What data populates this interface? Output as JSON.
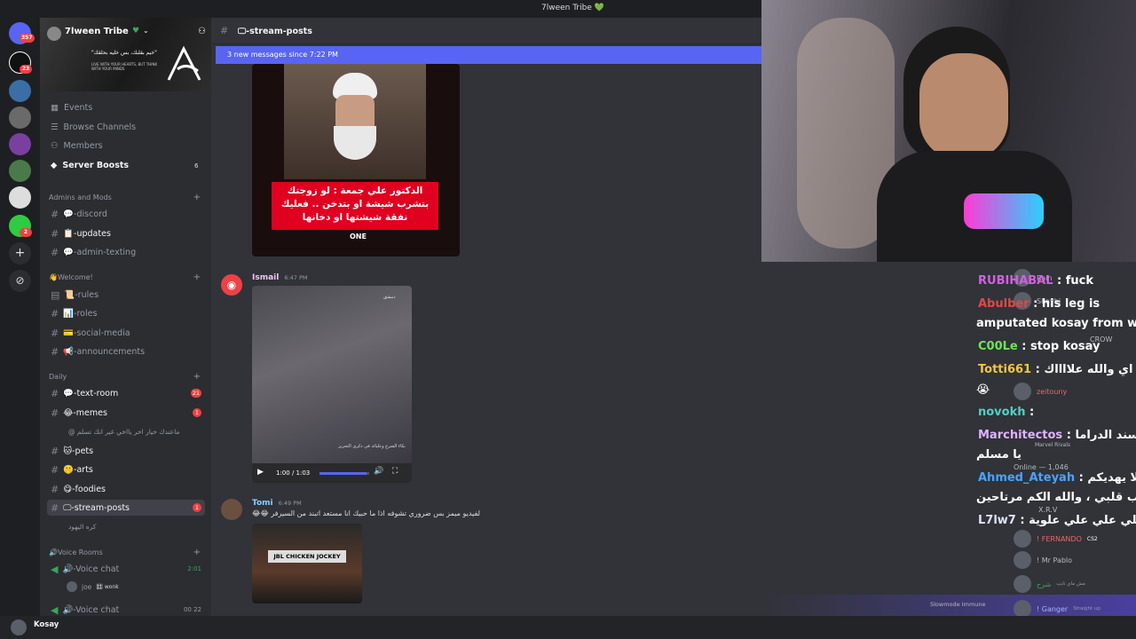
{
  "topbar": {
    "title": "7lween Tribe 💚"
  },
  "server_rail": {
    "badges": [
      "357",
      "23",
      "2"
    ]
  },
  "server": {
    "name": "7lween Tribe",
    "banner_text": "\"خيم بقلبك، بس خليه بحلقك\"",
    "banner_subtext": "LIVE WITH YOUR HEARTS, BUT THINK WITH YOUR MINDS"
  },
  "nav": [
    {
      "label": "Events",
      "icon": "calendar-icon"
    },
    {
      "label": "Browse Channels",
      "icon": "browse-icon"
    },
    {
      "label": "Members",
      "icon": "members-icon"
    },
    {
      "label": "Server Boosts",
      "icon": "boost-icon",
      "count": "6"
    }
  ],
  "categories": [
    {
      "label": "Admins and Mods",
      "channels": [
        "💬-discord",
        "📋-updates",
        "💬-admin-texting"
      ]
    },
    {
      "label": "👋Welcome!",
      "channels": [
        "📜-rules",
        "📊-roles",
        "💳-social-media",
        "📢-announcements"
      ]
    },
    {
      "label": "Daily",
      "channels": [
        {
          "name": "💬-text-room",
          "badge": "21"
        },
        {
          "name": "😂-memes",
          "badge": "1"
        },
        {
          "name": "@ ماعندك خيار اخر يااخي غير انك تسلم",
          "sub": true
        },
        {
          "name": "🐱-pets"
        },
        {
          "name": "🤫-arts"
        },
        {
          "name": "😋-foodies"
        },
        {
          "name": "🖵-stream-posts",
          "badge": "1",
          "active": true
        },
        {
          "name": "كره اليهود",
          "sub": true
        }
      ]
    },
    {
      "label": "🔊Voice Rooms",
      "voice": [
        {
          "name": "🔊-Voice chat",
          "time": "2:01",
          "user": "joe",
          "user_tag": "🎛 wonk"
        },
        {
          "name": "🔊-Voice chat",
          "time": "00 22"
        }
      ]
    }
  ],
  "channel_header": {
    "name": "🖵-stream-posts"
  },
  "new_messages": "3 new messages since 7:22 PM",
  "messages": [
    {
      "image_caption": "الدكتور علي جمعة : لو زوجتك بتشرب شيشة او بتدخن .. فعليك نفقة شيشتها او دخانها",
      "image_brand": "ONE"
    },
    {
      "author": "Ismail",
      "time": "6:47 PM",
      "video": {
        "time": "1:00 / 1:03",
        "progress": 0.95,
        "caption": "بكاء الشرع وعليائه في ذكرى التحرير",
        "tag": "دمشق"
      }
    },
    {
      "author": "Tomi",
      "time": "6:49 PM",
      "text": "لفيديو ميمز بس ضروري تشوفه اذا ما حبيك انا مستعد اتبند من السيرفر 😂😂",
      "image_caption": "JBL CHICKEN JOCKEY"
    }
  ],
  "reactions": [
    "👍",
    "😂",
    "💙"
  ],
  "stream_chat": [
    {
      "user": "RUBIHABAL",
      "text": " : fuck",
      "color": "#d55ee6"
    },
    {
      "user": "Abulber",
      "text": " : his leg is",
      "color": "#e04848"
    },
    {
      "user": "",
      "text": "amputated kosay from war",
      "color": "#ffffff"
    },
    {
      "user": "C00Le",
      "text": " : stop kosay",
      "color": "#6fe35a"
    },
    {
      "user": "Totti661",
      "text": " : اي والله علااااك",
      "color": "#f5c542"
    },
    {
      "user": "",
      "text": "😭",
      "color": "#ffffff"
    },
    {
      "user": "novokh",
      "text": " :",
      "color": "#4fd1c5"
    },
    {
      "user": "Marchitectos",
      "text": " : لا تقسند الدراما",
      "color": "#e0b3ff"
    },
    {
      "user": "",
      "text": "يا مسلم",
      "color": "#ffffff"
    },
    {
      "user": "Ahmed_Ateyah",
      "text": " : الله لا يهديكم",
      "color": "#4aa3ff"
    },
    {
      "user": "",
      "text": "ياحبايب قلبي ، والله الكم مرتاحين",
      "color": "#ffffff"
    },
    {
      "user": "L7lw7",
      "text": " : علي علي علي علي علوية",
      "color": "#dfe3ff"
    }
  ],
  "members_behind": [
    {
      "name": "Rain",
      "tag": "FCB"
    },
    {
      "name": "Shaybi"
    },
    {
      "name": "CROW"
    },
    {
      "name": "zeitouny"
    },
    {
      "name": "Marvel Rivals"
    },
    {
      "name": "Online — 1,046"
    },
    {
      "name": "X.R.V"
    },
    {
      "name": "! FERNANDO",
      "tag": "CS2"
    },
    {
      "name": "! Mr Pablo"
    },
    {
      "name": "شرح",
      "sub": "مش ماي تايب"
    },
    {
      "name": "! Ganger",
      "sub": "Straight up"
    }
  ],
  "slowmode": "Slowmode Immune",
  "user": {
    "name": "Kosay"
  }
}
